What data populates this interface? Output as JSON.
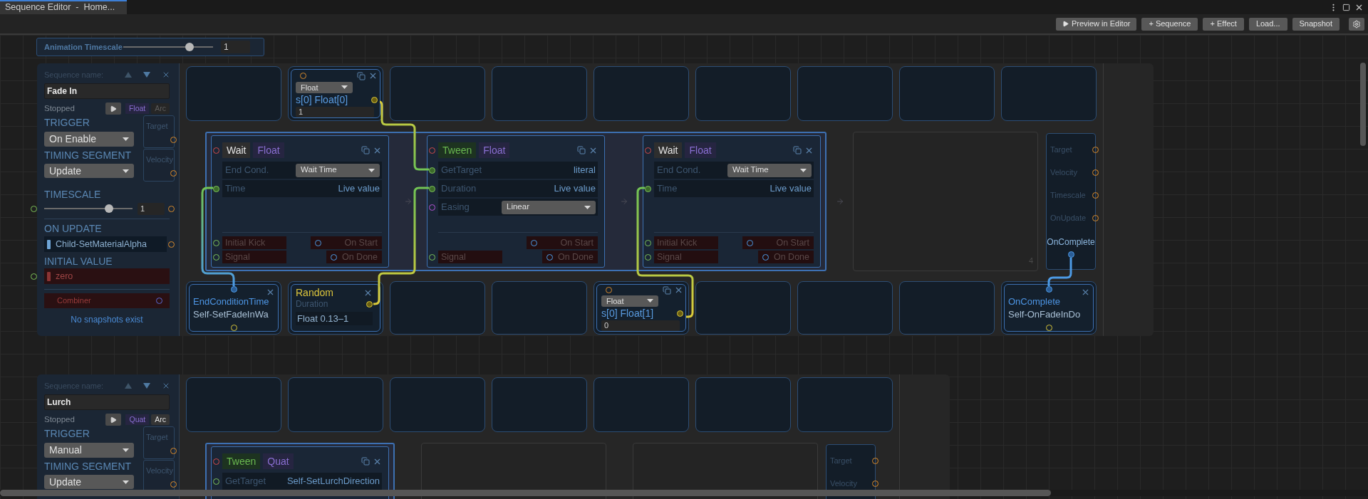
{
  "tab": {
    "title": "Sequence Editor  -  Home..."
  },
  "toolbar": {
    "buttons": [
      {
        "kind": "play",
        "label": "Preview in Editor"
      },
      {
        "kind": "text",
        "label": "+ Sequence"
      },
      {
        "kind": "text",
        "label": "+ Effect"
      },
      {
        "kind": "text",
        "label": "Load..."
      },
      {
        "kind": "text",
        "label": "Snapshot"
      },
      {
        "kind": "settings"
      }
    ]
  },
  "animation_timescale": {
    "label": "Animation Timescale",
    "level": 0.74,
    "value": "1"
  },
  "sequences": [
    {
      "name_label": "Sequence name:",
      "name": "Fade In",
      "status": "Stopped",
      "value_type": "Float",
      "arc": {
        "label": "Arc",
        "selected": false
      },
      "trigger": {
        "label": "TRIGGER",
        "value": "On Enable"
      },
      "timing": {
        "label": "TIMING SEGMENT",
        "value": "Update"
      },
      "side_ports": [
        "Target",
        "Velocity"
      ],
      "timescale": {
        "label": "TIMESCALE",
        "level": 0.73,
        "value": "1"
      },
      "on_update": {
        "label": "ON UPDATE",
        "value": "Child-SetMaterialAlpha"
      },
      "initial_value": {
        "label": "INITIAL VALUE",
        "value": "zero"
      },
      "combiner": "Combiner",
      "snapshots": "No snapshots exist",
      "top_slots": [
        {
          "kind": "empty"
        },
        {
          "kind": "value",
          "type": "Float",
          "title": "s[0] Float[0]",
          "value": "1"
        },
        {
          "kind": "empty"
        },
        {
          "kind": "empty"
        },
        {
          "kind": "empty"
        },
        {
          "kind": "empty"
        },
        {
          "kind": "empty"
        },
        {
          "kind": "empty"
        },
        {
          "kind": "empty"
        }
      ],
      "steps": [
        {
          "kind": "wait",
          "title": "Wait",
          "type": "Float",
          "rows": [
            {
              "kind": "setting",
              "label": "End Cond.",
              "value": "Wait Time"
            },
            {
              "kind": "input",
              "label": "Time",
              "value": "Live value",
              "connected": true
            }
          ],
          "inputs": [
            "Initial Kick",
            "Signal"
          ],
          "outputs": [
            "On Start",
            "On Done"
          ]
        },
        {
          "kind": "tween",
          "title": "Tween",
          "type": "Float",
          "rows": [
            {
              "kind": "input",
              "label": "GetTarget",
              "value": "literal",
              "connected": true
            },
            {
              "kind": "input",
              "label": "Duration",
              "value": "Live value",
              "connected": true
            },
            {
              "kind": "curve",
              "label": "Easing",
              "value": "Linear"
            }
          ],
          "inputs": [
            "Signal"
          ],
          "outputs": [
            "On Start",
            "On Done"
          ]
        },
        {
          "kind": "wait",
          "title": "Wait",
          "type": "Float",
          "rows": [
            {
              "kind": "setting",
              "label": "End Cond.",
              "value": "Wait Time"
            },
            {
              "kind": "input",
              "label": "Time",
              "value": "Live value",
              "connected": true
            }
          ],
          "inputs": [
            "Initial Kick",
            "Signal"
          ],
          "outputs": [
            "On Start",
            "On Done"
          ]
        }
      ],
      "end_slots": [
        {
          "kind": "numbered",
          "label": "4"
        }
      ],
      "outputs": [
        {
          "label": "Target",
          "active": false
        },
        {
          "label": "Velocity",
          "active": false
        },
        {
          "label": "Timescale",
          "active": false
        },
        {
          "label": "OnUpdate",
          "active": false
        },
        {
          "label": "OnComplete",
          "active": true
        }
      ],
      "bottom_slots": [
        {
          "kind": "binding",
          "title": "EndConditionTime",
          "value": "Self-SetFadeInWa"
        },
        {
          "kind": "random",
          "title": "Random",
          "subtitle": "Duration",
          "value": "Float 0.13–1"
        },
        {
          "kind": "empty"
        },
        {
          "kind": "empty"
        },
        {
          "kind": "value",
          "type": "Float",
          "title": "s[0] Float[1]",
          "value": "0"
        },
        {
          "kind": "empty"
        },
        {
          "kind": "empty"
        },
        {
          "kind": "empty"
        },
        {
          "kind": "event",
          "title": "OnComplete",
          "value": "Self-OnFadeInDo"
        }
      ]
    },
    {
      "name_label": "Sequence name:",
      "name": "Lurch",
      "status": "Stopped",
      "value_type": "Quat",
      "arc": {
        "label": "Arc",
        "selected": true
      },
      "trigger": {
        "label": "TRIGGER",
        "value": "Manual"
      },
      "timing": {
        "label": "TIMING SEGMENT",
        "value": "Update"
      },
      "side_ports": [
        "Target",
        "Velocity"
      ],
      "top_slots": [
        {
          "kind": "empty"
        },
        {
          "kind": "empty"
        },
        {
          "kind": "empty"
        },
        {
          "kind": "empty"
        },
        {
          "kind": "empty"
        },
        {
          "kind": "empty"
        },
        {
          "kind": "empty"
        }
      ],
      "steps": [
        {
          "kind": "tween",
          "title": "Tween",
          "type": "Quat",
          "rows": [
            {
              "kind": "input",
              "label": "GetTarget",
              "value": "Self-SetLurchDirection",
              "connected": false
            }
          ]
        }
      ],
      "end_slots": [
        {
          "kind": "empty"
        },
        {
          "kind": "empty"
        }
      ],
      "outputs": [
        {
          "label": "Target",
          "active": false
        },
        {
          "label": "Velocity",
          "active": false
        }
      ]
    }
  ]
}
